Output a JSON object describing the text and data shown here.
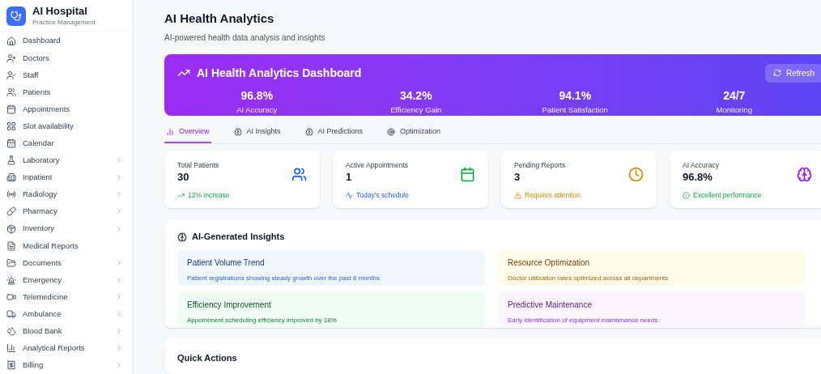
{
  "brand": {
    "name": "AI Hospital",
    "subtitle": "Practice Management"
  },
  "sidebar": {
    "items": [
      {
        "label": "Dashboard",
        "has_submenu": false
      },
      {
        "label": "Doctors",
        "has_submenu": false
      },
      {
        "label": "Staff",
        "has_submenu": false
      },
      {
        "label": "Patients",
        "has_submenu": false
      },
      {
        "label": "Appointments",
        "has_submenu": false
      },
      {
        "label": "Slot availability",
        "has_submenu": false
      },
      {
        "label": "Calendar",
        "has_submenu": false
      },
      {
        "label": "Laboratory",
        "has_submenu": true
      },
      {
        "label": "Inpatient",
        "has_submenu": true
      },
      {
        "label": "Radiology",
        "has_submenu": true
      },
      {
        "label": "Pharmacy",
        "has_submenu": true
      },
      {
        "label": "Inventory",
        "has_submenu": true
      },
      {
        "label": "Medical Reports",
        "has_submenu": false
      },
      {
        "label": "Documents",
        "has_submenu": true
      },
      {
        "label": "Emergency",
        "has_submenu": true
      },
      {
        "label": "Telemedicine",
        "has_submenu": true
      },
      {
        "label": "Ambulance",
        "has_submenu": true
      },
      {
        "label": "Blood Bank",
        "has_submenu": true
      },
      {
        "label": "Analytical Reports",
        "has_submenu": true
      },
      {
        "label": "Billing",
        "has_submenu": true
      }
    ]
  },
  "page": {
    "title": "AI Health Analytics",
    "subtitle": "AI-powered health data analysis and insights"
  },
  "hero": {
    "title": "AI Health Analytics Dashboard",
    "refresh": "Refresh",
    "metrics": [
      {
        "value": "96.8%",
        "label": "AI Accuracy"
      },
      {
        "value": "34.2%",
        "label": "Efficiency Gain"
      },
      {
        "value": "94.1%",
        "label": "Patient Satisfaction"
      },
      {
        "value": "24/7",
        "label": "Monitoring"
      }
    ]
  },
  "tabs": [
    {
      "label": "Overview",
      "selected": true
    },
    {
      "label": "AI Insights",
      "selected": false
    },
    {
      "label": "AI Predictions",
      "selected": false
    },
    {
      "label": "Optimization",
      "selected": false
    }
  ],
  "stats": [
    {
      "label": "Total Patients",
      "value": "30",
      "note": "12% increase",
      "kind": "positive"
    },
    {
      "label": "Active Appointments",
      "value": "1",
      "note": "Today's schedule",
      "kind": "info"
    },
    {
      "label": "Pending Reports",
      "value": "3",
      "note": "Requires attention",
      "kind": "warning"
    },
    {
      "label": "AI Accuracy",
      "value": "96.8%",
      "note": "Excellent performance",
      "kind": "positive"
    }
  ],
  "insights": {
    "title": "AI-Generated Insights",
    "items": [
      {
        "title": "Patient Volume Trend",
        "text": "Patient registrations showing steady growth over the past 6 months",
        "color": "#eff6ff"
      },
      {
        "title": "Resource Optimization",
        "text": "Doctor utilization rates optimized across all departments",
        "color": "#fefce8"
      },
      {
        "title": "Efficiency Improvement",
        "text": "Appointment scheduling efficiency improved by 18%",
        "color": "#f0fdf4"
      },
      {
        "title": "Predictive Maintenance",
        "text": "Early identification of equipment maintenance needs",
        "color": "#faf5ff"
      }
    ]
  },
  "quick_actions": {
    "title": "Quick Actions"
  }
}
